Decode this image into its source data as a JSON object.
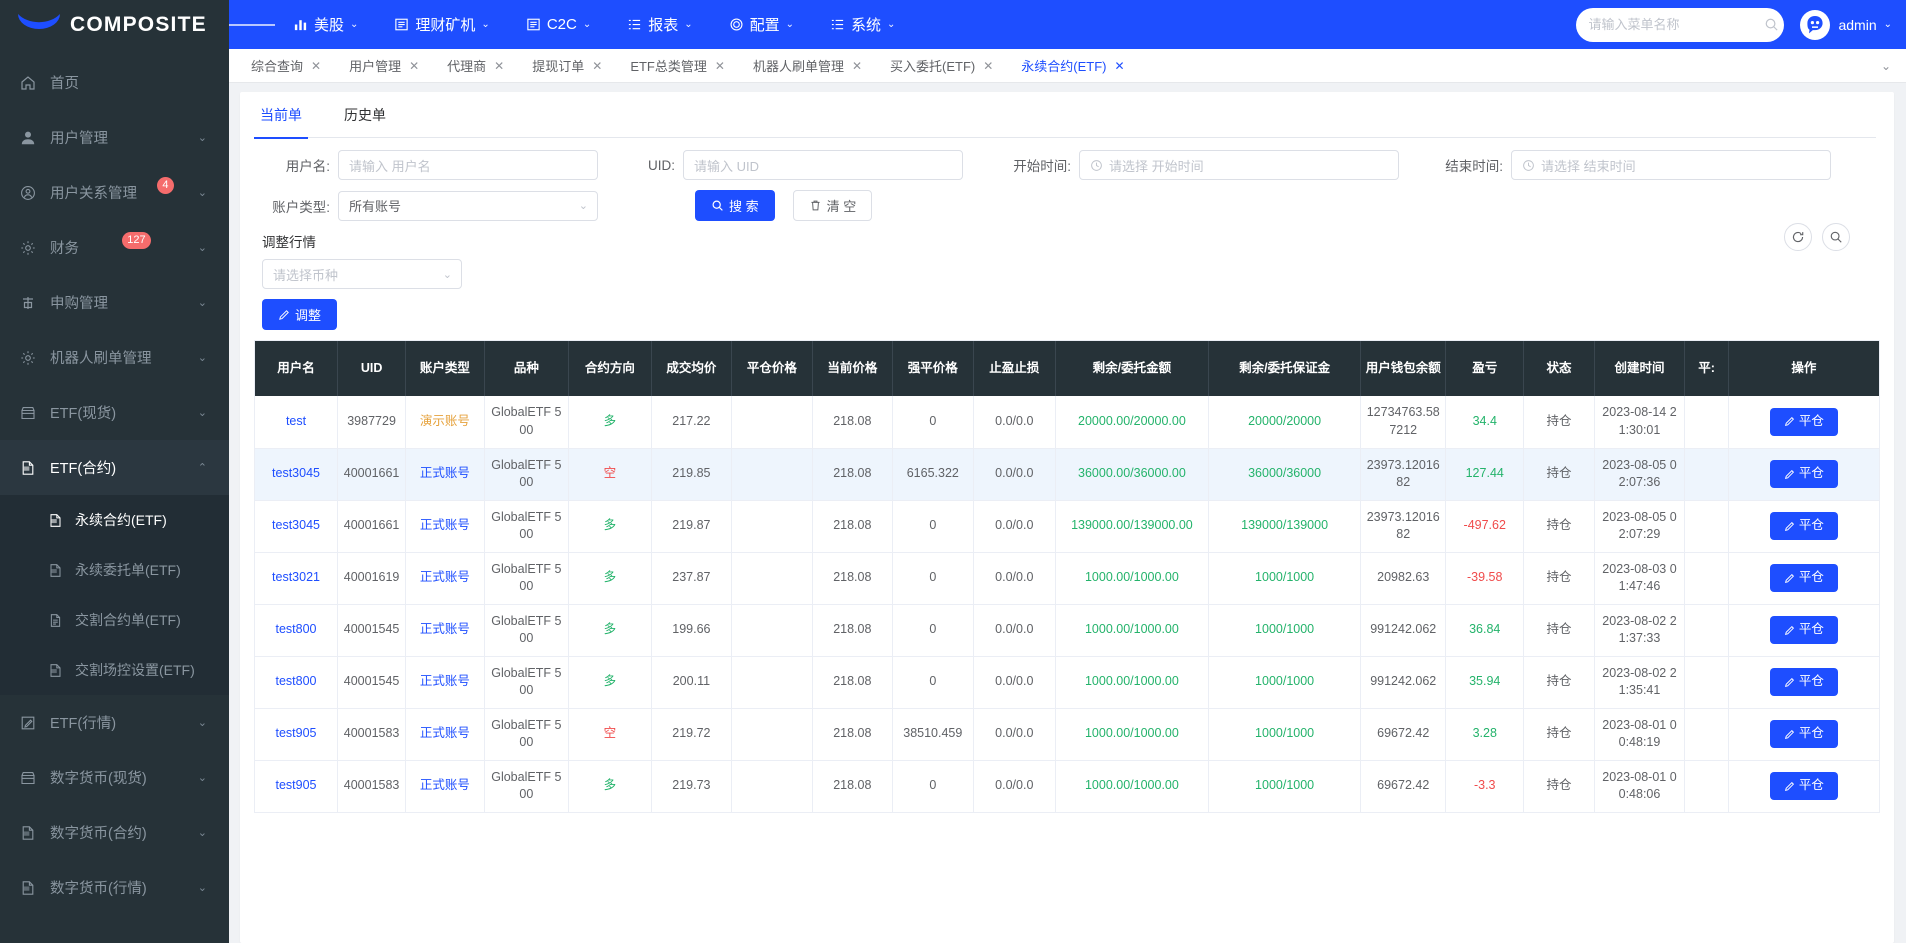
{
  "brand": {
    "name": "COMPOSITE",
    "logo_icon": "crescent-logo"
  },
  "topnav": {
    "hamburger_icon": "hamburger-icon",
    "items": [
      {
        "label": "美股",
        "icon": "chart-bar-icon",
        "caret": "⌄"
      },
      {
        "label": "理财矿机",
        "icon": "list-box-icon",
        "caret": "⌄"
      },
      {
        "label": "C2C",
        "icon": "list-box-icon",
        "caret": "⌄"
      },
      {
        "label": "报表",
        "icon": "report-list-icon",
        "caret": "⌄"
      },
      {
        "label": "配置",
        "icon": "gear-icon",
        "caret": "⌄"
      },
      {
        "label": "系统",
        "icon": "report-list-icon",
        "caret": "⌄"
      }
    ],
    "search": {
      "placeholder": "请输入菜单名称",
      "value": "",
      "icon": "search-icon"
    },
    "user": {
      "name": "admin",
      "avatar_icon": "robot-avatar-icon",
      "caret": "⌄"
    }
  },
  "sidebar": {
    "items": [
      {
        "label": "首页",
        "icon": "home-icon",
        "badge": "",
        "arrow": "",
        "state": "normal"
      },
      {
        "label": "用户管理",
        "icon": "user-icon",
        "badge": "",
        "arrow": "⌄",
        "state": "normal"
      },
      {
        "label": "用户关系管理",
        "icon": "user-circle-icon",
        "badge": "4",
        "arrow": "⌄",
        "state": "normal"
      },
      {
        "label": "财务",
        "icon": "gear-icon",
        "badge": "127",
        "arrow": "⌄",
        "state": "normal"
      },
      {
        "label": "申购管理",
        "icon": "ticket-icon",
        "badge": "",
        "arrow": "⌄",
        "state": "normal"
      },
      {
        "label": "机器人刷单管理",
        "icon": "gear-icon",
        "badge": "",
        "arrow": "⌄",
        "state": "normal"
      },
      {
        "label": "ETF(现货)",
        "icon": "shop-icon",
        "badge": "",
        "arrow": "⌄",
        "state": "normal"
      },
      {
        "label": "ETF(合约)",
        "icon": "sql-doc-icon",
        "badge": "",
        "arrow": "⌃",
        "state": "active-open"
      }
    ],
    "submenu": [
      {
        "label": "永续合约(ETF)",
        "icon": "sql-doc-icon",
        "active": true
      },
      {
        "label": "永续委托单(ETF)",
        "icon": "sql-doc-icon",
        "active": false
      },
      {
        "label": "交割合约单(ETF)",
        "icon": "file-icon",
        "active": false
      },
      {
        "label": "交割场控设置(ETF)",
        "icon": "sql-doc-icon",
        "active": false
      }
    ],
    "items_after": [
      {
        "label": "ETF(行情)",
        "icon": "edit-square-icon",
        "badge": "",
        "arrow": "⌄"
      },
      {
        "label": "数字货币(现货)",
        "icon": "shop-icon",
        "badge": "",
        "arrow": "⌄"
      },
      {
        "label": "数字货币(合约)",
        "icon": "sql-doc-icon",
        "badge": "",
        "arrow": "⌄"
      },
      {
        "label": "数字货币(行情)",
        "icon": "sql-doc-icon",
        "badge": "",
        "arrow": "⌄"
      }
    ]
  },
  "tabs": {
    "items": [
      {
        "label": "综合查询",
        "active": false
      },
      {
        "label": "用户管理",
        "active": false
      },
      {
        "label": "代理商",
        "active": false
      },
      {
        "label": "提现订单",
        "active": false
      },
      {
        "label": "ETF总类管理",
        "active": false
      },
      {
        "label": "机器人刷单管理",
        "active": false
      },
      {
        "label": "买入委托(ETF)",
        "active": false
      },
      {
        "label": "永续合约(ETF)",
        "active": true
      }
    ],
    "close_icon": "close-icon",
    "more_icon": "chevron-down-icon"
  },
  "inner_tabs": [
    {
      "label": "当前单",
      "active": true
    },
    {
      "label": "历史单",
      "active": false
    }
  ],
  "search_form": {
    "username": {
      "label": "用户名:",
      "placeholder": "请输入 用户名",
      "value": ""
    },
    "uid": {
      "label": "UID:",
      "placeholder": "请输入 UID",
      "value": ""
    },
    "start_time": {
      "label": "开始时间:",
      "placeholder": "请选择 开始时间",
      "value": "",
      "icon": "clock-icon"
    },
    "end_time": {
      "label": "结束时间:",
      "placeholder": "请选择 结束时间",
      "value": "",
      "icon": "clock-icon"
    },
    "account_type": {
      "label": "账户类型:",
      "value": "所有账号",
      "caret": "⌄"
    },
    "search_button": {
      "label": "搜 索",
      "icon": "search-icon"
    },
    "clear_button": {
      "label": "清 空",
      "icon": "trash-icon"
    }
  },
  "adjust_section": {
    "title": "调整行情",
    "coin_select": {
      "placeholder": "请选择币种",
      "value": "",
      "caret": "⌄"
    },
    "adjust_button": {
      "label": "调整",
      "icon": "pencil-icon"
    },
    "refresh_icon": "refresh-icon",
    "zoom_icon": "search-circle-icon"
  },
  "table": {
    "columns": [
      "用户名",
      "UID",
      "账户类型",
      "品种",
      "合约方向",
      "成交均价",
      "平仓价格",
      "当前价格",
      "强平价格",
      "止盈止损",
      "剩余/委托金额",
      "剩余/委托保证金",
      "用户钱包余额",
      "盈亏",
      "状态",
      "创建时间",
      "平:",
      "操作"
    ],
    "rows": [
      {
        "username": "test",
        "uid": "3987729",
        "account_type": "演示账号",
        "account_type_style": "orange",
        "variety": "GlobalETF 500",
        "direction": "多",
        "direction_style": "long",
        "avg_price": "217.22",
        "close_price": "",
        "current_price": "218.08",
        "liq_price": "0",
        "tp_sl": "0.0/0.0",
        "remain_amount": "20000.00/20000.00",
        "remain_margin": "20000/20000",
        "wallet": "12734763.587212",
        "pnl": "34.4",
        "pnl_style": "green",
        "status": "持仓",
        "created": "2023-08-14 21:30:01",
        "flat": "",
        "action": "平仓",
        "striped": false
      },
      {
        "username": "test3045",
        "uid": "40001661",
        "account_type": "正式账号",
        "account_type_style": "blue",
        "variety": "GlobalETF 500",
        "direction": "空",
        "direction_style": "short",
        "avg_price": "219.85",
        "close_price": "",
        "current_price": "218.08",
        "liq_price": "6165.322",
        "tp_sl": "0.0/0.0",
        "remain_amount": "36000.00/36000.00",
        "remain_margin": "36000/36000",
        "wallet": "23973.1201682",
        "pnl": "127.44",
        "pnl_style": "green",
        "status": "持仓",
        "created": "2023-08-05 02:07:36",
        "flat": "",
        "action": "平仓",
        "striped": true
      },
      {
        "username": "test3045",
        "uid": "40001661",
        "account_type": "正式账号",
        "account_type_style": "blue",
        "variety": "GlobalETF 500",
        "direction": "多",
        "direction_style": "long",
        "avg_price": "219.87",
        "close_price": "",
        "current_price": "218.08",
        "liq_price": "0",
        "tp_sl": "0.0/0.0",
        "remain_amount": "139000.00/139000.00",
        "remain_margin": "139000/139000",
        "wallet": "23973.1201682",
        "pnl": "-497.62",
        "pnl_style": "red",
        "status": "持仓",
        "created": "2023-08-05 02:07:29",
        "flat": "",
        "action": "平仓",
        "striped": false
      },
      {
        "username": "test3021",
        "uid": "40001619",
        "account_type": "正式账号",
        "account_type_style": "blue",
        "variety": "GlobalETF 500",
        "direction": "多",
        "direction_style": "long",
        "avg_price": "237.87",
        "close_price": "",
        "current_price": "218.08",
        "liq_price": "0",
        "tp_sl": "0.0/0.0",
        "remain_amount": "1000.00/1000.00",
        "remain_margin": "1000/1000",
        "wallet": "20982.63",
        "pnl": "-39.58",
        "pnl_style": "red",
        "status": "持仓",
        "created": "2023-08-03 01:47:46",
        "flat": "",
        "action": "平仓",
        "striped": false
      },
      {
        "username": "test800",
        "uid": "40001545",
        "account_type": "正式账号",
        "account_type_style": "blue",
        "variety": "GlobalETF 500",
        "direction": "多",
        "direction_style": "long",
        "avg_price": "199.66",
        "close_price": "",
        "current_price": "218.08",
        "liq_price": "0",
        "tp_sl": "0.0/0.0",
        "remain_amount": "1000.00/1000.00",
        "remain_margin": "1000/1000",
        "wallet": "991242.062",
        "pnl": "36.84",
        "pnl_style": "green",
        "status": "持仓",
        "created": "2023-08-02 21:37:33",
        "flat": "",
        "action": "平仓",
        "striped": false
      },
      {
        "username": "test800",
        "uid": "40001545",
        "account_type": "正式账号",
        "account_type_style": "blue",
        "variety": "GlobalETF 500",
        "direction": "多",
        "direction_style": "long",
        "avg_price": "200.11",
        "close_price": "",
        "current_price": "218.08",
        "liq_price": "0",
        "tp_sl": "0.0/0.0",
        "remain_amount": "1000.00/1000.00",
        "remain_margin": "1000/1000",
        "wallet": "991242.062",
        "pnl": "35.94",
        "pnl_style": "green",
        "status": "持仓",
        "created": "2023-08-02 21:35:41",
        "flat": "",
        "action": "平仓",
        "striped": false
      },
      {
        "username": "test905",
        "uid": "40001583",
        "account_type": "正式账号",
        "account_type_style": "blue",
        "variety": "GlobalETF 500",
        "direction": "空",
        "direction_style": "short",
        "avg_price": "219.72",
        "close_price": "",
        "current_price": "218.08",
        "liq_price": "38510.459",
        "tp_sl": "0.0/0.0",
        "remain_amount": "1000.00/1000.00",
        "remain_margin": "1000/1000",
        "wallet": "69672.42",
        "pnl": "3.28",
        "pnl_style": "green",
        "status": "持仓",
        "created": "2023-08-01 00:48:19",
        "flat": "",
        "action": "平仓",
        "striped": false
      },
      {
        "username": "test905",
        "uid": "40001583",
        "account_type": "正式账号",
        "account_type_style": "blue",
        "variety": "GlobalETF 500",
        "direction": "多",
        "direction_style": "long",
        "avg_price": "219.73",
        "close_price": "",
        "current_price": "218.08",
        "liq_price": "0",
        "tp_sl": "0.0/0.0",
        "remain_amount": "1000.00/1000.00",
        "remain_margin": "1000/1000",
        "wallet": "69672.42",
        "pnl": "-3.3",
        "pnl_style": "red",
        "status": "持仓",
        "created": "2023-08-01 00:48:06",
        "flat": "",
        "action": "平仓",
        "striped": false
      }
    ],
    "action_icon": "pencil-icon"
  },
  "colors": {
    "primary": "#1e4eff",
    "sidebar_bg": "#263238",
    "header_bg": "#263238",
    "green": "#24b36b",
    "red": "#f04b4b",
    "orange": "#e6a23c",
    "badge": "#f56c6c"
  }
}
